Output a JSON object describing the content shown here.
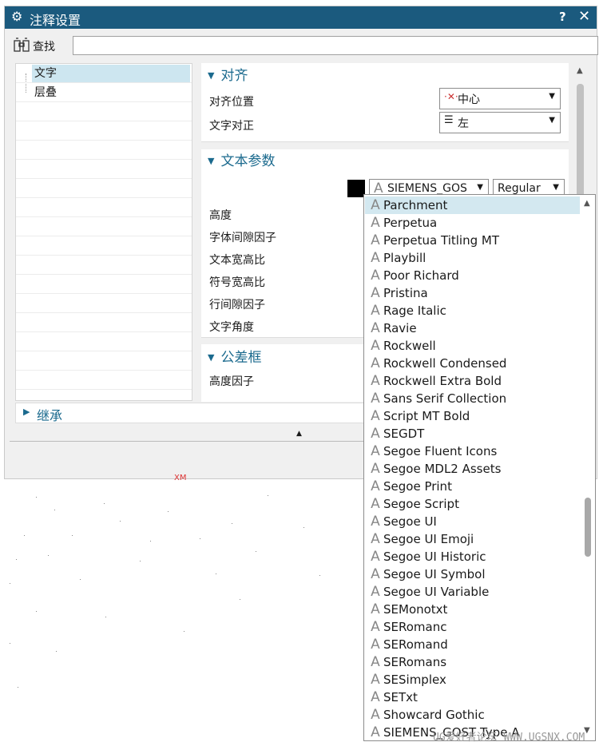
{
  "window": {
    "title": "注释设置",
    "help": "?",
    "close": "✕"
  },
  "find": {
    "label": "查找",
    "value": ""
  },
  "tree": {
    "items": [
      {
        "label": "文字",
        "selected": true
      },
      {
        "label": "层叠",
        "selected": false
      }
    ]
  },
  "sections": {
    "align": {
      "title": "对齐",
      "position_label": "对齐位置",
      "position_value": "中心",
      "justify_label": "文字对正",
      "justify_value": "左"
    },
    "text_params": {
      "title": "文本参数",
      "color": "#000000",
      "font_value": "SIEMENS_GOS",
      "style_value": "Regular",
      "labels": [
        "高度",
        "字体间隙因子",
        "文本宽高比",
        "符号宽高比",
        "行间隙因子",
        "文字角度"
      ]
    },
    "tolerance": {
      "title": "公差框",
      "height_factor_label": "高度因子"
    },
    "inherit": {
      "title": "继承"
    }
  },
  "font_list": {
    "highlighted": "Parchment",
    "items": [
      "Parchment",
      "Perpetua",
      "Perpetua Titling MT",
      "Playbill",
      "Poor Richard",
      "Pristina",
      "Rage Italic",
      "Ravie",
      "Rockwell",
      "Rockwell Condensed",
      "Rockwell Extra Bold",
      "Sans Serif Collection",
      "Script MT Bold",
      "SEGDT",
      "Segoe Fluent Icons",
      "Segoe MDL2 Assets",
      "Segoe Print",
      "Segoe Script",
      "Segoe UI",
      "Segoe UI Emoji",
      "Segoe UI Historic",
      "Segoe UI Symbol",
      "Segoe UI Variable",
      "SEMonotxt",
      "SERomanc",
      "SERomand",
      "SERomans",
      "SESimplex",
      "SETxt",
      "Showcard Gothic",
      "SIEMENS_GOST Type A"
    ]
  },
  "background": {
    "mark": "XM",
    "watermark": "UG爱好者论坛 WWW.UGSNX.COM"
  },
  "colors": {
    "title_bar": "#1b5a7e",
    "section_header": "#1b6a8e",
    "selection": "#cde6f0"
  }
}
